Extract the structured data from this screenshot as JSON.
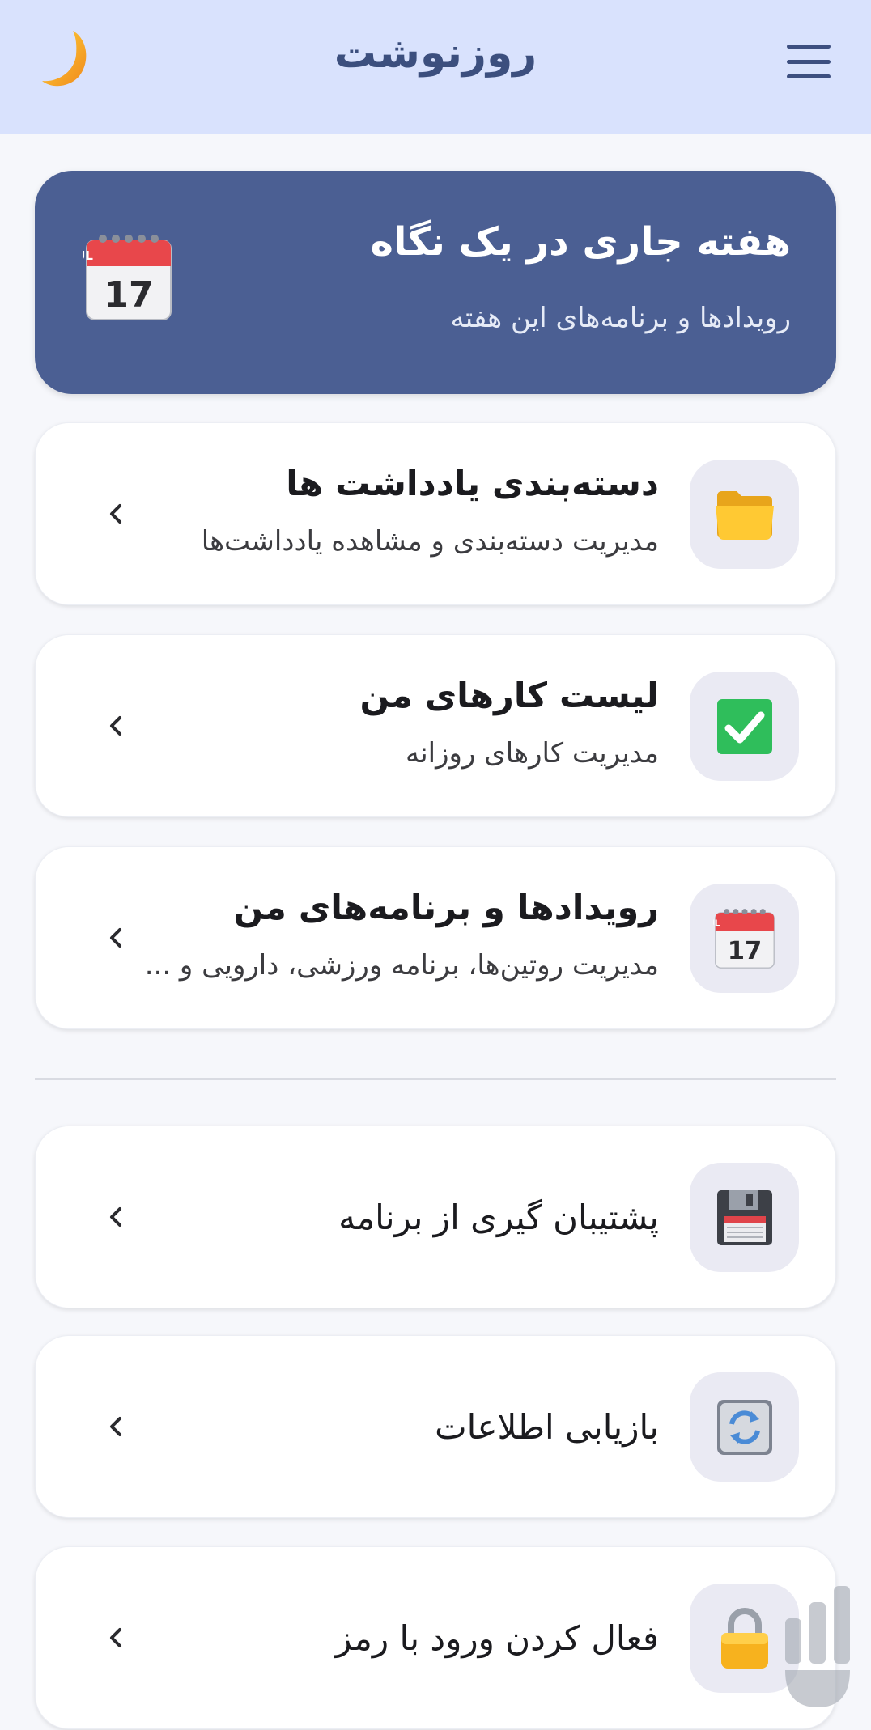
{
  "header": {
    "title": "روزنوشت",
    "menu_icon": "hamburger-icon",
    "theme_icon": "moon-icon"
  },
  "hero": {
    "title": "هفته جاری در یک نگاه",
    "subtitle": "رویدادها و برنامه‌های این هفته",
    "icon": "calendar-icon",
    "calendar_month": "JUL",
    "calendar_day": "17"
  },
  "cards": [
    {
      "title": "دسته‌بندی یادداشت ها",
      "subtitle": "مدیریت دسته‌بندی و مشاهده یادداشت‌ها",
      "icon": "folder-icon"
    },
    {
      "title": "لیست کارهای من",
      "subtitle": "مدیریت کارهای روزانه",
      "icon": "checkmark-icon"
    },
    {
      "title": "رویدادها و برنامه‌های من",
      "subtitle": "مدیریت روتین‌ها، برنامه ورزشی، دارویی و ...",
      "icon": "calendar-icon",
      "calendar_month": "JUL",
      "calendar_day": "17"
    }
  ],
  "settings": [
    {
      "title": "پشتیبان گیری از برنامه",
      "icon": "floppy-disk-icon"
    },
    {
      "title": "بازیابی اطلاعات",
      "icon": "refresh-icon"
    },
    {
      "title": "فعال کردن ورود با رمز",
      "icon": "lock-icon"
    }
  ],
  "colors": {
    "header_bg": "#d9e2fd",
    "hero_bg": "#4b5f93",
    "page_bg": "#f6f7fb",
    "icon_tile_bg": "#eaeaf3"
  }
}
